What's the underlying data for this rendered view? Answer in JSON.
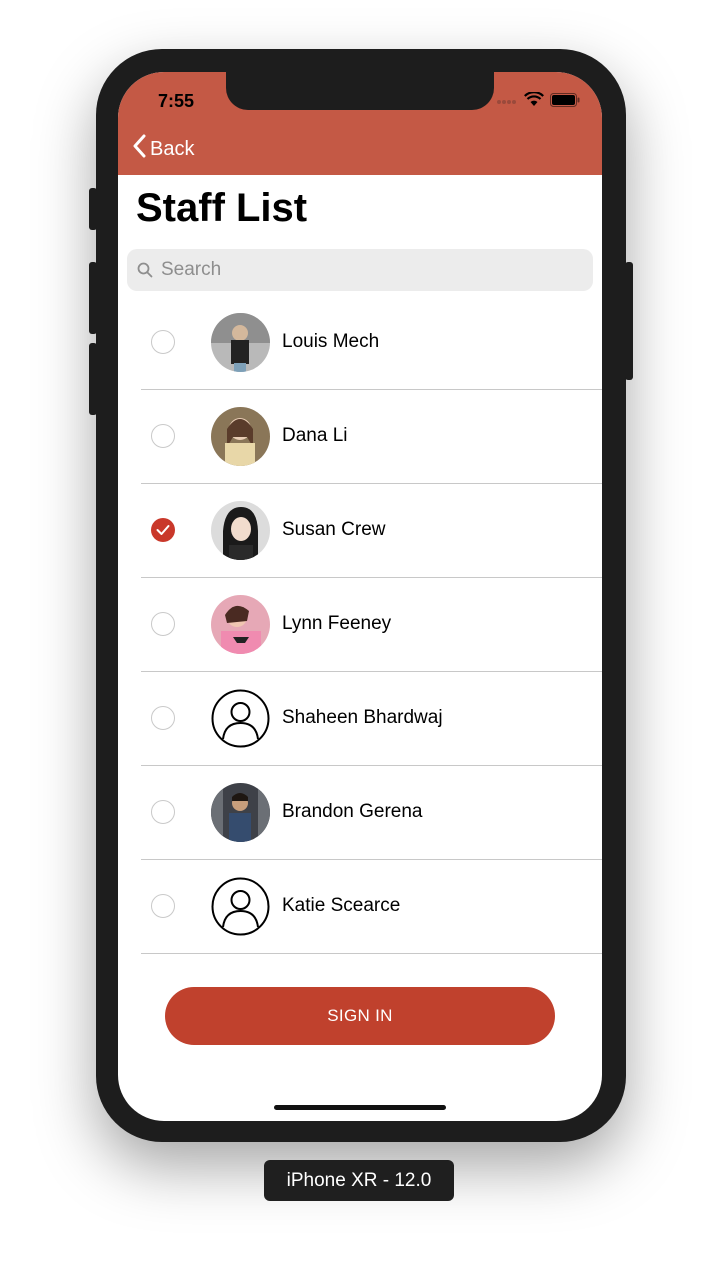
{
  "status_bar": {
    "time": "7:55"
  },
  "nav": {
    "back_label": "Back"
  },
  "page": {
    "title": "Staff List"
  },
  "search": {
    "placeholder": "Search"
  },
  "staff": [
    {
      "name": "Louis Mech",
      "selected": false,
      "avatar": "photo"
    },
    {
      "name": "Dana Li",
      "selected": false,
      "avatar": "photo"
    },
    {
      "name": "Susan Crew",
      "selected": true,
      "avatar": "photo"
    },
    {
      "name": "Lynn Feeney",
      "selected": false,
      "avatar": "photo"
    },
    {
      "name": "Shaheen Bhardwaj",
      "selected": false,
      "avatar": "user-placeholder-icon"
    },
    {
      "name": "Brandon Gerena",
      "selected": false,
      "avatar": "photo"
    },
    {
      "name": "Katie Scearce",
      "selected": false,
      "avatar": "user-placeholder-icon"
    }
  ],
  "actions": {
    "sign_in_label": "SIGN IN"
  },
  "device": {
    "label": "iPhone XR - 12.0"
  },
  "colors": {
    "accent": "#c45945",
    "button": "#c0412d",
    "check": "#c9382a"
  }
}
